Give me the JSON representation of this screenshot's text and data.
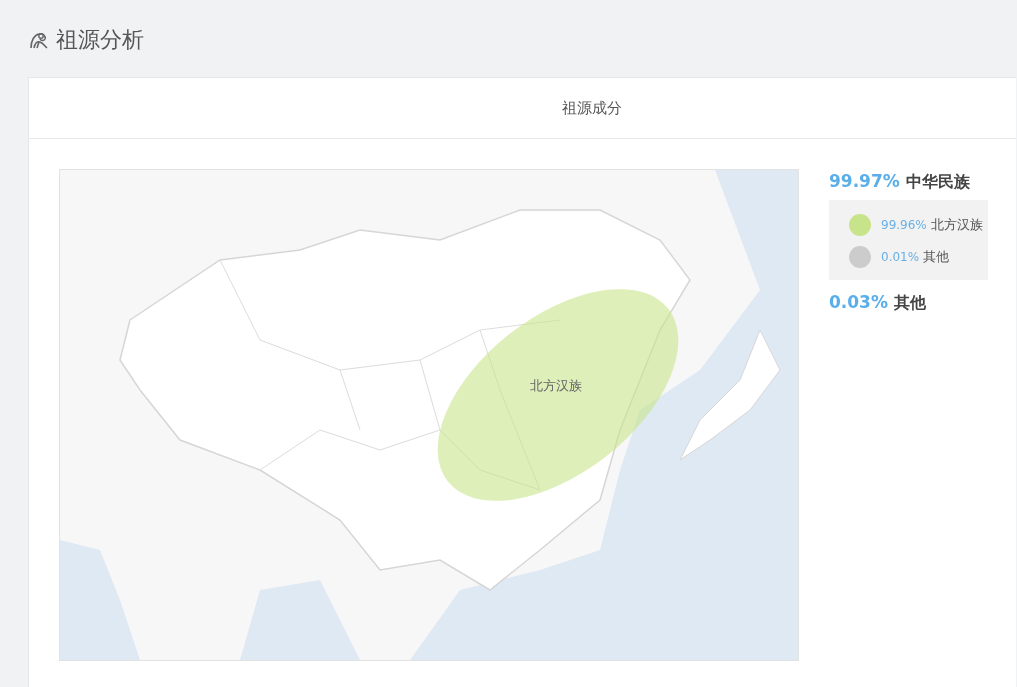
{
  "page": {
    "title": "祖源分析"
  },
  "card": {
    "title": "祖源成分"
  },
  "map": {
    "region_label": "北方汉族"
  },
  "groups": [
    {
      "percent": "99.97%",
      "name": "中华民族",
      "children": [
        {
          "percent": "99.96%",
          "name": "北方汉族",
          "color": "#c8e48a"
        },
        {
          "percent": "0.01%",
          "name": "其他",
          "color": "#cccccc"
        }
      ]
    },
    {
      "percent": "0.03%",
      "name": "其他"
    }
  ]
}
